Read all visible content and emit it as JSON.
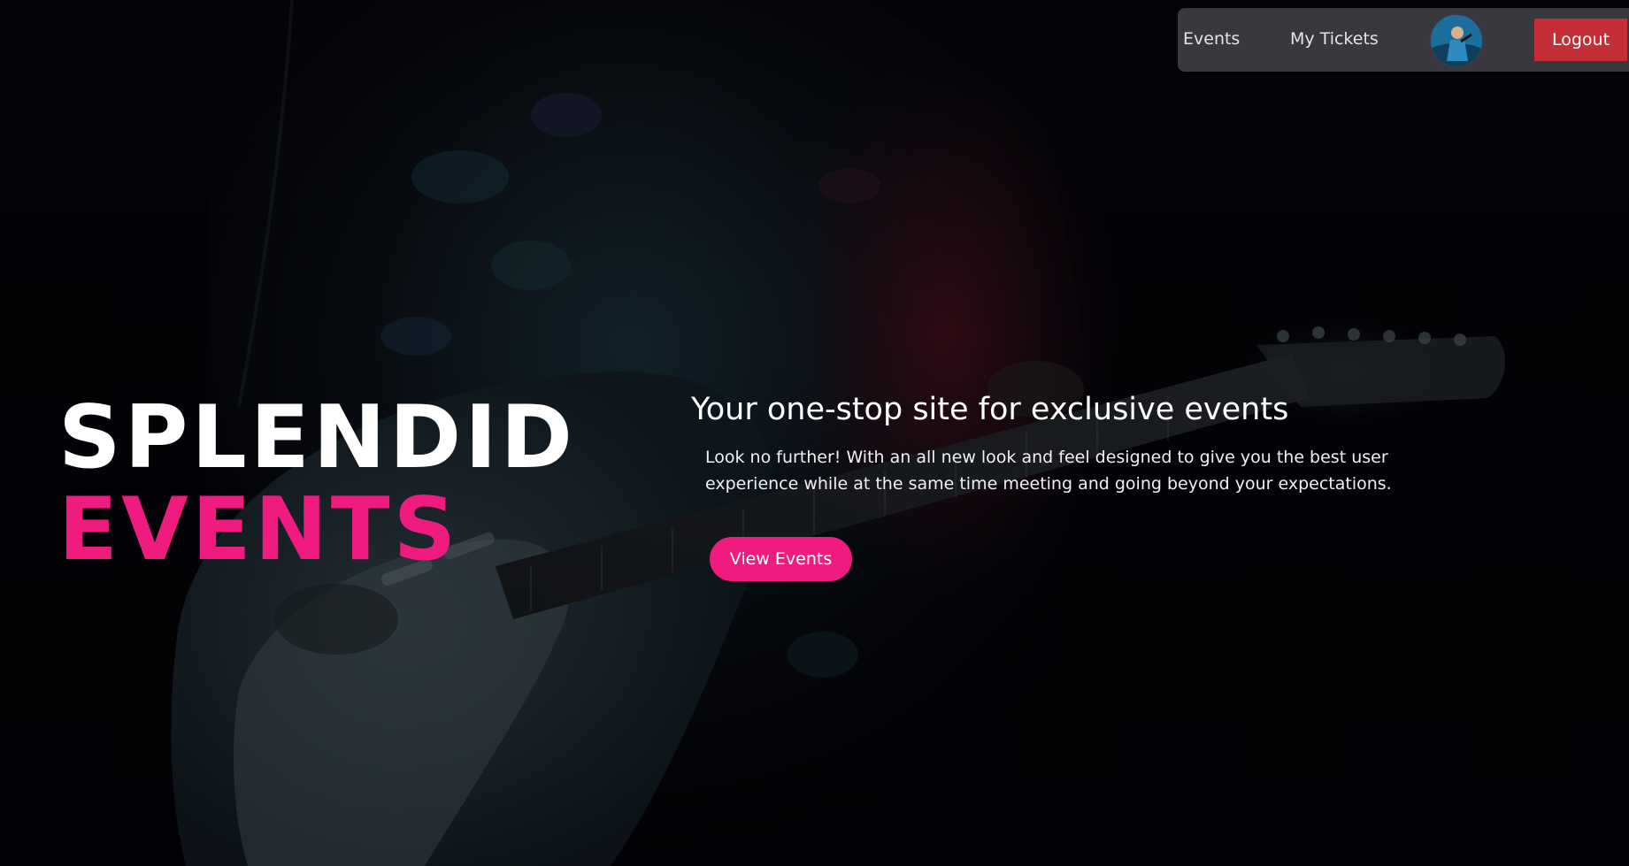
{
  "nav": {
    "events_label": "Events",
    "tickets_label": "My Tickets",
    "logout_label": "Logout",
    "avatar_icon": "user-avatar-icon"
  },
  "hero": {
    "brand_line_1": "SPLENDID",
    "brand_line_2": "EVENTS",
    "tagline": "Your one-stop site for exclusive events",
    "description": "Look no further! With an all new look and feel designed to give you the best user experience while at the same time meeting and going beyond your expectations.",
    "cta_label": "View Events"
  },
  "colors": {
    "accent": "#f01b7e",
    "logout": "#c42f37",
    "nav_background": "#464448"
  }
}
